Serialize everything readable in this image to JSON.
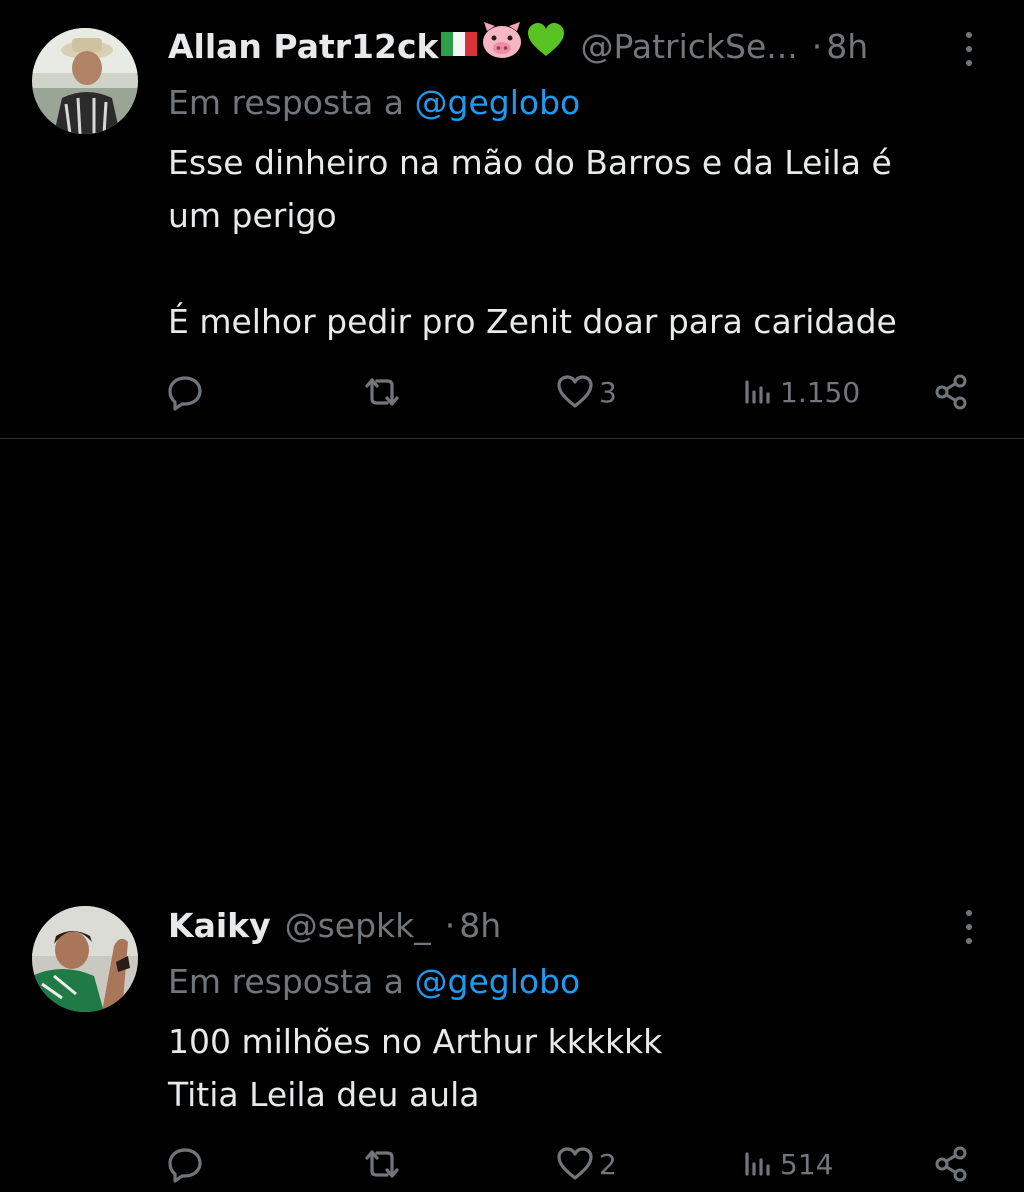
{
  "tweets": [
    {
      "name": "Allan Patr12ck",
      "name_emojis": [
        "italy-flag-emoji",
        "pig-face-emoji",
        "green-heart-emoji"
      ],
      "handle": "@PatrickSe...",
      "dot": "·",
      "time": "8h",
      "reply_prefix": "Em resposta a",
      "reply_to": "@geglobo",
      "body_lines": [
        "Esse dinheiro na mão do Barros e da Leila é",
        "um perigo",
        "",
        "É melhor pedir pro Zenit doar para caridade"
      ],
      "likes": "3",
      "views": "1.150"
    },
    {
      "name": "Kaiky",
      "name_emojis": [],
      "handle": "@sepkk_",
      "dot": "·",
      "time": "8h",
      "reply_prefix": "Em resposta a",
      "reply_to": "@geglobo",
      "body_lines": [
        "100 milhões no Arthur kkkkkk",
        "Titia Leila deu aula"
      ],
      "likes": "2",
      "views": "514"
    }
  ],
  "icons": {
    "reply": "reply-icon",
    "retweet": "retweet-icon",
    "like": "heart-icon",
    "views": "views-icon",
    "share": "share-icon",
    "more": "more-icon"
  },
  "colors": {
    "background": "#000000",
    "text": "#e7e9ea",
    "secondary": "#71767b",
    "mention": "#1d9bf0",
    "divider": "#2f3336"
  }
}
